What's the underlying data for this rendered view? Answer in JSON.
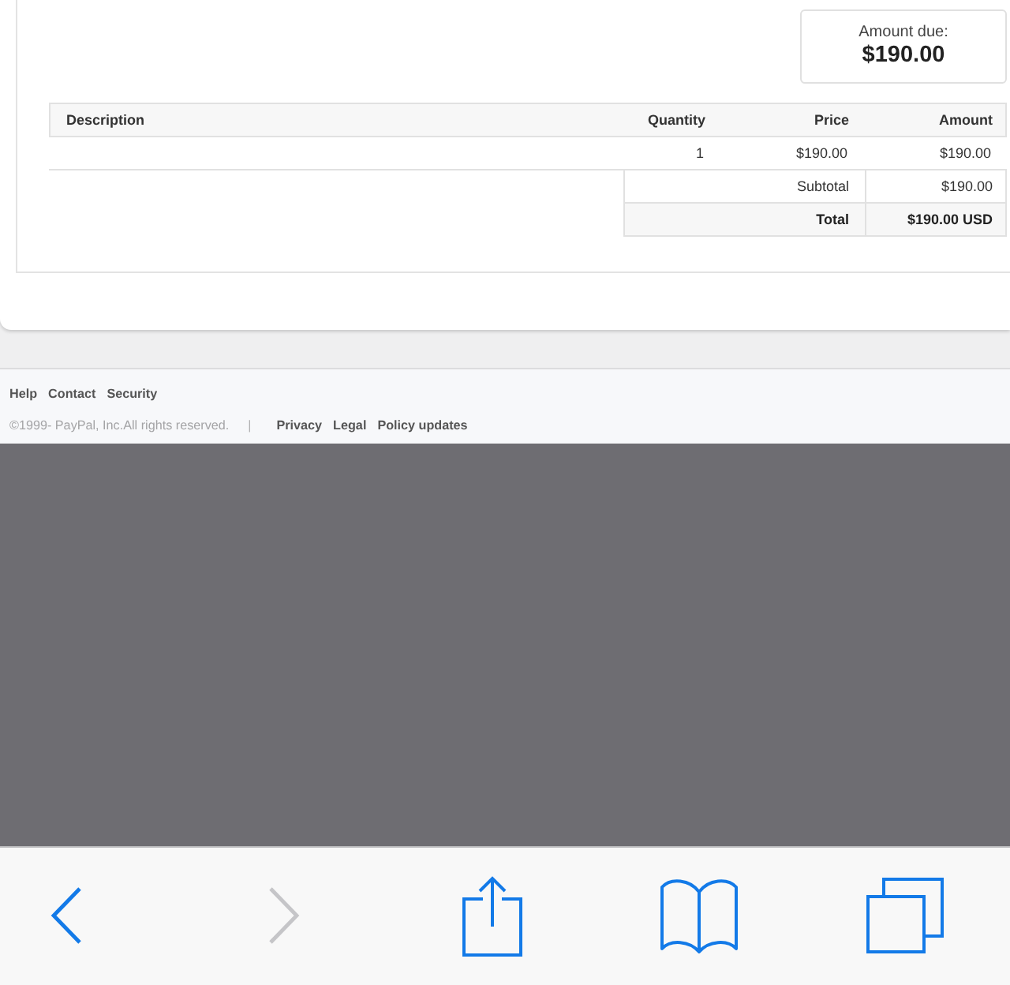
{
  "amount_due": {
    "label": "Amount due:",
    "value": "$190.00"
  },
  "table": {
    "columns": [
      "Description",
      "Quantity",
      "Price",
      "Amount"
    ],
    "rows": [
      {
        "quantity": "1",
        "price": "$190.00",
        "amount": "$190.00"
      }
    ]
  },
  "totals": [
    {
      "kind": "subtotal",
      "label": "Subtotal",
      "value": "$190.00"
    },
    {
      "kind": "total",
      "label": "Total",
      "value": "$190.00 USD"
    }
  ],
  "footer": {
    "links": [
      "Help",
      "Contact",
      "Security"
    ],
    "copyright": "©1999- PayPal, Inc.All rights reserved.",
    "separator": "|",
    "legal_links": [
      "Privacy",
      "Legal",
      "Policy updates"
    ]
  },
  "toolbar": {
    "buttons": [
      {
        "kind": "back",
        "disabled": false
      },
      {
        "kind": "forward",
        "disabled": true
      },
      {
        "kind": "share",
        "disabled": false
      },
      {
        "kind": "bookmarks",
        "disabled": false
      },
      {
        "kind": "tabs",
        "disabled": false
      }
    ]
  }
}
